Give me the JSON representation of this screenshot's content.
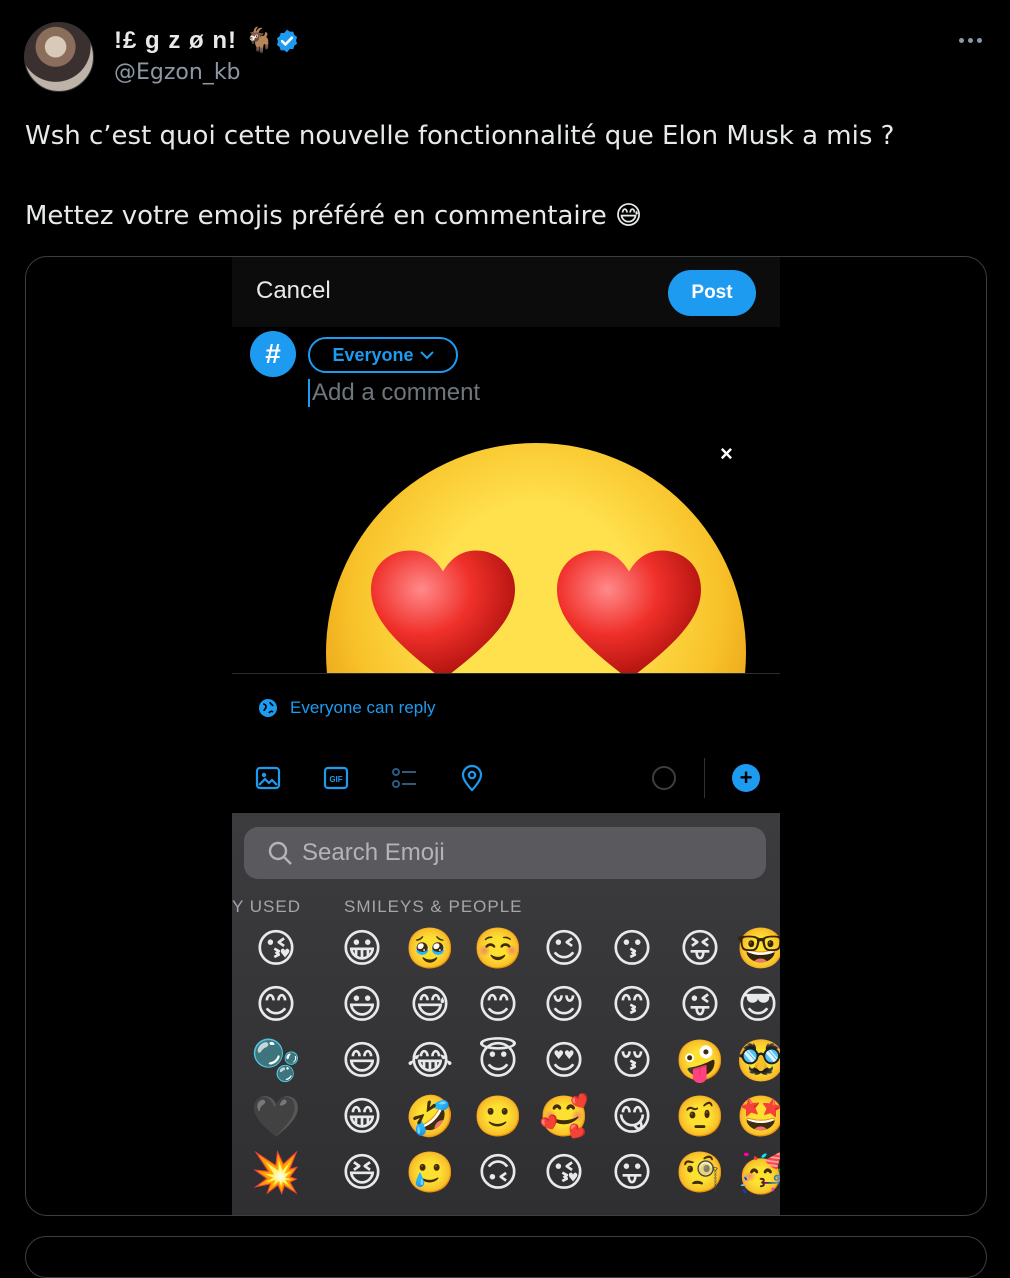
{
  "author": {
    "display_name": "!£ g z ø n!",
    "name_emoji": "🐐",
    "handle": "@Egzon_kb",
    "verified_color": "#1d9bf0"
  },
  "tweet": {
    "line1": "Wsh c’est quoi cette nouvelle fonctionnalité que Elon Musk a mis ?",
    "line2": "Mettez votre emojis préféré en commentaire",
    "line2_emoji": "😅"
  },
  "composer": {
    "cancel_label": "Cancel",
    "post_label": "Post",
    "avatar_symbol": "#",
    "audience_label": "Everyone",
    "comment_placeholder": "Add a comment",
    "close_symbol": "×",
    "reply_setting": "Everyone can reply",
    "add_symbol": "+"
  },
  "keyboard": {
    "search_placeholder": "Search Emoji",
    "recent_label": "Y USED",
    "smileys_label": "SMILEYS & PEOPLE",
    "recent": [
      "😘",
      "😊",
      "🫧",
      "🖤",
      "💥"
    ],
    "grid": [
      [
        "😀",
        "🥹",
        "☺️",
        "😉",
        "😗",
        "😝",
        "🤓"
      ],
      [
        "😃",
        "😅",
        "😊",
        "😌",
        "😙",
        "😜",
        "😎"
      ],
      [
        "😄",
        "😂",
        "😇",
        "😍",
        "😚",
        "🤪",
        "🥸"
      ],
      [
        "😁",
        "🤣",
        "🙂",
        "🥰",
        "😋",
        "🤨",
        "🤩"
      ],
      [
        "😆",
        "🥲",
        "🙃",
        "😘",
        "😛",
        "🧐",
        "🥳"
      ]
    ]
  },
  "colors": {
    "accent": "#1d9bf0",
    "background": "#000000",
    "text": "#e7e9ea",
    "secondary": "#8b98a5"
  }
}
